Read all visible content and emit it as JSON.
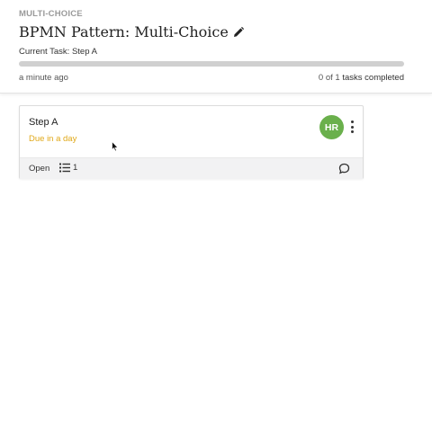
{
  "header": {
    "kicker": "MULTI-CHOICE",
    "title": "BPMN Pattern: Multi-Choice",
    "current_task": "Current Task: Step A",
    "progress": 0.0,
    "updated": "a minute ago",
    "tasks_completed_prefix": "0 of 1",
    "tasks_completed_suffix": "tasks completed"
  },
  "card": {
    "name": "Step A",
    "due": "Due in a day",
    "assignee_initials": "HR",
    "status": "Open",
    "subtask_count": "1"
  },
  "colors": {
    "avatar": "#6ab04c",
    "due": "#e0a818",
    "progress_track": "#d0d0d0"
  },
  "icons": {
    "edit": "pencil-icon",
    "more": "vertical-dots-icon",
    "subtasks": "list-icon",
    "comments": "speech-bubble-icon",
    "cursor": "mouse-pointer-icon"
  }
}
